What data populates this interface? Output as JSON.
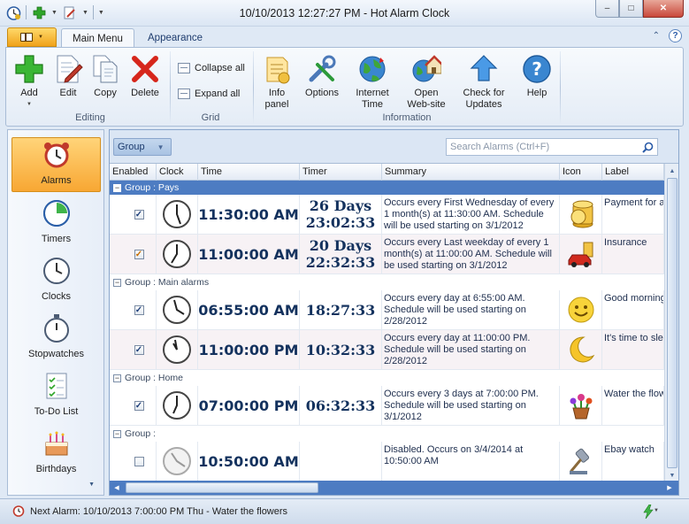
{
  "window": {
    "title": "10/10/2013 12:27:27 PM - Hot Alarm Clock",
    "minimize": "–",
    "maximize": "□",
    "close": "✕"
  },
  "tabs": [
    {
      "label": "Main Menu",
      "active": true
    },
    {
      "label": "Appearance",
      "active": false
    }
  ],
  "ribbon": {
    "editing": {
      "group_label": "Editing",
      "add": "Add",
      "edit": "Edit",
      "copy": "Copy",
      "delete": "Delete"
    },
    "grid": {
      "group_label": "Grid",
      "collapse_all": "Collapse all",
      "expand_all": "Expand all"
    },
    "information": {
      "group_label": "Information",
      "info_panel": "Info panel",
      "options": "Options",
      "internet_time": "Internet Time",
      "open_website": "Open Web-site",
      "check_updates": "Check for Updates",
      "help": "Help"
    }
  },
  "nav": [
    {
      "label": "Alarms",
      "icon": "alarm-clock-icon",
      "active": true
    },
    {
      "label": "Timers",
      "icon": "timer-icon",
      "active": false
    },
    {
      "label": "Clocks",
      "icon": "clock-icon",
      "active": false
    },
    {
      "label": "Stopwatches",
      "icon": "stopwatch-icon",
      "active": false
    },
    {
      "label": "To-Do List",
      "icon": "todo-list-icon",
      "active": false
    },
    {
      "label": "Birthdays",
      "icon": "birthday-cake-icon",
      "active": false
    }
  ],
  "grid": {
    "group_by_label": "Group",
    "search_placeholder": "Search Alarms (Ctrl+F)",
    "columns": [
      "Enabled",
      "Clock",
      "Time",
      "Timer",
      "Summary",
      "Icon",
      "Label"
    ],
    "groups": [
      {
        "label": "Group : Pays",
        "toggle": "−"
      },
      {
        "label": "Group : Main alarms",
        "toggle": "−"
      },
      {
        "label": "Group : Home",
        "toggle": "−"
      },
      {
        "label": "Group :",
        "toggle": "−"
      }
    ],
    "rows": [
      {
        "enabled": "✓",
        "time": "11:30:00 AM",
        "timer_line1": "26 Days",
        "timer_line2": "23:02:33",
        "summary": "Occurs every First Wednesday of every 1 month(s) at 11:30:00 AM. Schedule will be used starting on 3/1/2012",
        "icon": "coins-icon",
        "label": "Payment for a"
      },
      {
        "enabled": "✓",
        "time": "11:00:00 AM",
        "timer_line1": "20 Days",
        "timer_line2": "22:32:33",
        "summary": "Occurs every Last weekday of every 1 month(s) at 11:00:00 AM. Schedule will be used starting on 3/1/2012",
        "icon": "car-money-icon",
        "label": "Insurance"
      },
      {
        "enabled": "✓",
        "time": "06:55:00 AM",
        "timer_line1": "18:27:33",
        "timer_line2": "",
        "summary": "Occurs every day at 6:55:00 AM. Schedule will be used starting on 2/28/2012",
        "icon": "smiley-icon",
        "label": "Good morning"
      },
      {
        "enabled": "✓",
        "time": "11:00:00 PM",
        "timer_line1": "10:32:33",
        "timer_line2": "",
        "summary": "Occurs every day at 11:00:00 PM. Schedule will be used starting on 2/28/2012",
        "icon": "moon-icon",
        "label": "It's time to sle"
      },
      {
        "enabled": "✓",
        "time": "07:00:00 PM",
        "timer_line1": "06:32:33",
        "timer_line2": "",
        "summary": "Occurs every 3 days at 7:00:00 PM. Schedule will be used starting on 3/1/2012",
        "icon": "flower-pot-icon",
        "label": "Water the flow"
      },
      {
        "enabled": "",
        "time": "10:50:00 AM",
        "timer_line1": "",
        "timer_line2": "",
        "summary": "Disabled. Occurs on 3/4/2014 at 10:50:00 AM",
        "icon": "auction-hammer-icon",
        "label": "Ebay watch"
      }
    ]
  },
  "statusbar": {
    "next_alarm": "Next Alarm: 10/10/2013 7:00:00 PM Thu - Water the flowers"
  }
}
